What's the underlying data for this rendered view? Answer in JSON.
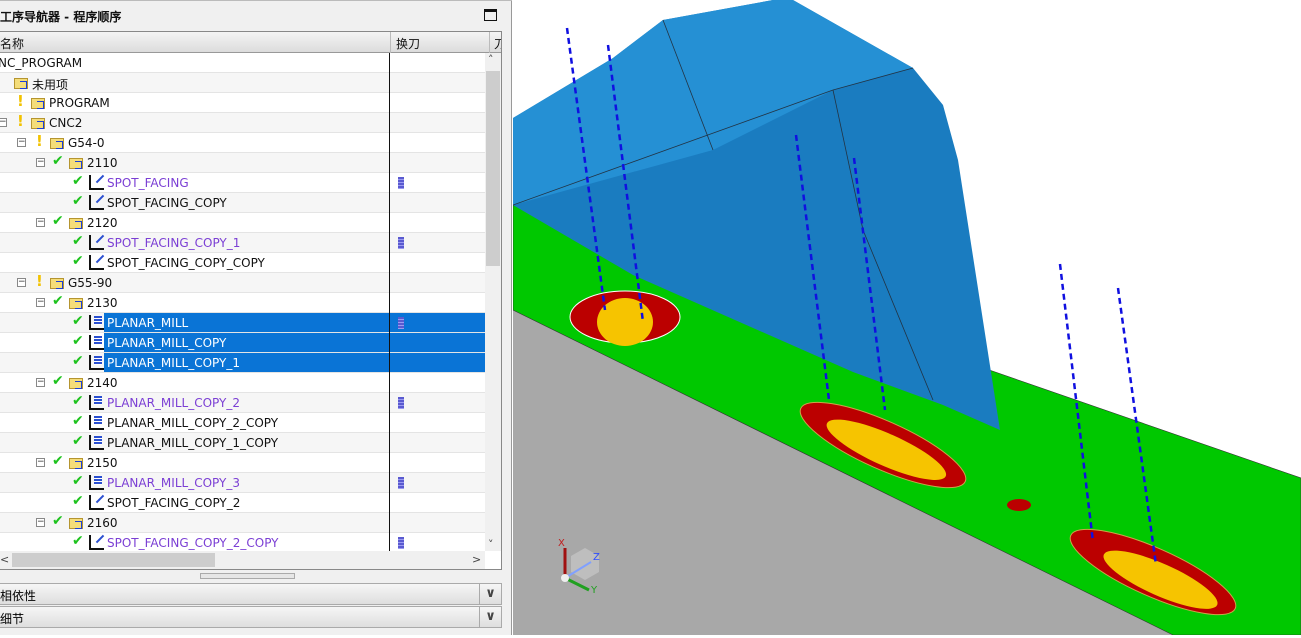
{
  "navigator": {
    "title": "工序导航器 - 程序顺序",
    "columns": {
      "name": "名称",
      "tool_change": "换刀",
      "next_col_partial": "刀"
    },
    "rows": [
      {
        "label": "NC_PROGRAM",
        "level": 0,
        "kind": "root"
      },
      {
        "label": "未用项",
        "level": 1,
        "kind": "group"
      },
      {
        "label": "PROGRAM",
        "level": 1,
        "kind": "group",
        "status": "bulb"
      },
      {
        "label": "CNC2",
        "level": 1,
        "kind": "group",
        "status": "bulb",
        "toggle": true
      },
      {
        "label": "G54-0",
        "level": 2,
        "kind": "group",
        "status": "bulb",
        "toggle": true
      },
      {
        "label": "2110",
        "level": 3,
        "kind": "group",
        "status": "check",
        "toggle": true
      },
      {
        "label": "SPOT_FACING",
        "level": 4,
        "kind": "spot",
        "status": "check",
        "purple": true,
        "tool": true
      },
      {
        "label": "SPOT_FACING_COPY",
        "level": 4,
        "kind": "spot",
        "status": "check"
      },
      {
        "label": "2120",
        "level": 3,
        "kind": "group",
        "status": "check",
        "toggle": true
      },
      {
        "label": "SPOT_FACING_COPY_1",
        "level": 4,
        "kind": "spot",
        "status": "check",
        "purple": true,
        "tool": true
      },
      {
        "label": "SPOT_FACING_COPY_COPY",
        "level": 4,
        "kind": "spot",
        "status": "check"
      },
      {
        "label": "G55-90",
        "level": 2,
        "kind": "group",
        "status": "bulb",
        "toggle": true
      },
      {
        "label": "2130",
        "level": 3,
        "kind": "group",
        "status": "check",
        "toggle": true
      },
      {
        "label": "PLANAR_MILL",
        "level": 4,
        "kind": "planar",
        "status": "check",
        "selected": true,
        "tool": true
      },
      {
        "label": "PLANAR_MILL_COPY",
        "level": 4,
        "kind": "planar",
        "status": "check",
        "selected": true
      },
      {
        "label": "PLANAR_MILL_COPY_1",
        "level": 4,
        "kind": "planar",
        "status": "check",
        "selected": true
      },
      {
        "label": "2140",
        "level": 3,
        "kind": "group",
        "status": "check",
        "toggle": true
      },
      {
        "label": "PLANAR_MILL_COPY_2",
        "level": 4,
        "kind": "planar",
        "status": "check",
        "purple": true,
        "tool": true
      },
      {
        "label": "PLANAR_MILL_COPY_2_COPY",
        "level": 4,
        "kind": "planar",
        "status": "check"
      },
      {
        "label": "PLANAR_MILL_COPY_1_COPY",
        "level": 4,
        "kind": "planar",
        "status": "check"
      },
      {
        "label": "2150",
        "level": 3,
        "kind": "group",
        "status": "check",
        "toggle": true
      },
      {
        "label": "PLANAR_MILL_COPY_3",
        "level": 4,
        "kind": "planar",
        "status": "check",
        "purple": true,
        "tool": true
      },
      {
        "label": "SPOT_FACING_COPY_2",
        "level": 4,
        "kind": "spot",
        "status": "check"
      },
      {
        "label": "2160",
        "level": 3,
        "kind": "group",
        "status": "check",
        "toggle": true
      },
      {
        "label": "SPOT_FACING_COPY_2_COPY",
        "level": 4,
        "kind": "spot",
        "status": "check",
        "purple": true,
        "tool": true
      }
    ],
    "sections": [
      "相依性",
      "细节"
    ]
  },
  "triad": {
    "x": "X",
    "y": "Y",
    "z": "Z"
  },
  "colors": {
    "selection": "#0a74d6",
    "purple_text": "#7b3fd4",
    "part_blue": "#1a7cc0",
    "plate_green": "#00c800",
    "face_gray": "#a8a8a8"
  }
}
